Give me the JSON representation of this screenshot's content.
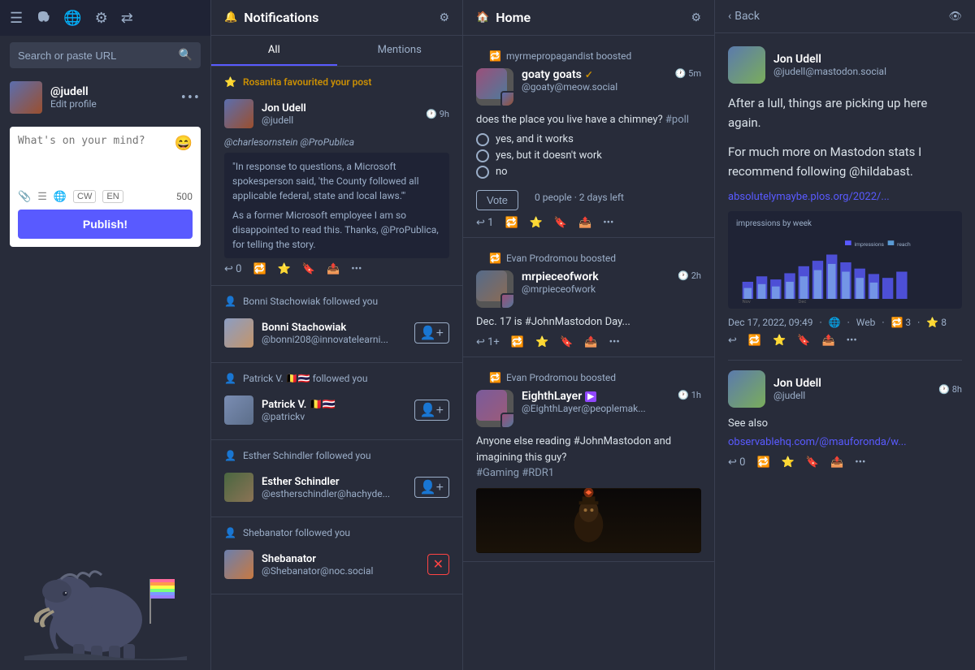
{
  "sidebar": {
    "nav": {
      "menu_icon": "≡",
      "ghost_icon": "👻",
      "globe_icon": "🌐",
      "gear_icon": "⚙",
      "arrows_icon": "⇄"
    },
    "search": {
      "placeholder": "Search or paste URL",
      "icon": "🔍"
    },
    "profile": {
      "handle": "@judell",
      "action": "Edit profile",
      "dots": "•••"
    },
    "compose": {
      "placeholder": "What's on your mind?",
      "emoji": "😄",
      "char_count": "500",
      "cw_label": "CW",
      "en_label": "EN",
      "publish_label": "Publish!"
    }
  },
  "notifications": {
    "header": {
      "icon": "🔔",
      "title": "Notifications",
      "filter_icon": "⚙"
    },
    "tabs": [
      {
        "label": "All",
        "active": true
      },
      {
        "label": "Mentions",
        "active": false
      }
    ],
    "groups": [
      {
        "type": "favourite",
        "icon": "⭐",
        "label_html": "Rosanita favourited your post",
        "user": {
          "name": "Jon Udell",
          "handle": "@judell",
          "time": "9h",
          "avatar_class": "av-jon"
        },
        "mention": "@charlesornstein @ProPublica",
        "text_block": "\"In response to questions, a Microsoft spokesperson said, 'the County followed all applicable federal, state and local laws.'\"",
        "text_block2": "As a former Microsoft employee I am so disappointed to read this. Thanks, @ProPublica, for telling the story.",
        "actions": [
          "↩ 0",
          "🔁",
          "⭐",
          "🔖",
          "📤",
          "•••"
        ]
      },
      {
        "type": "follow",
        "icon": "👤+",
        "label": "Bonni Stachowiak followed you",
        "user": {
          "name": "Bonni Stachowiak",
          "handle": "@bonni208@innovatelearni...",
          "avatar_class": "av-bonni"
        }
      },
      {
        "type": "follow",
        "icon": "👤+",
        "label": "Patrick V.",
        "label2": "🇧🇪🇹🇭 followed you",
        "user": {
          "name": "Patrick V.",
          "flags": "🇧🇪🇹🇭",
          "handle": "@patrickv",
          "avatar_class": "av-patrick"
        }
      },
      {
        "type": "follow",
        "icon": "👤+",
        "label": "Esther Schindler followed you",
        "user": {
          "name": "Esther Schindler",
          "handle": "@estherschindler@hachyde...",
          "avatar_class": "av-esther"
        }
      },
      {
        "type": "follow",
        "icon": "👤+",
        "label": "Shebanator followed you",
        "user": {
          "name": "Shebanator",
          "handle": "@Shebanator@noc.social",
          "avatar_class": "av-sheba"
        }
      }
    ]
  },
  "home": {
    "header": {
      "icon": "🏠",
      "title": "Home",
      "filter_icon": "⚙"
    },
    "posts": [
      {
        "boost_by": "myrmepropagandist boosted",
        "user": {
          "name": "goaty goats",
          "verified": true,
          "handle": "@goaty@meow.social",
          "time": "5m",
          "avatar_class": "av-goaty"
        },
        "content": "does the place you live have a chimney?",
        "hashtag": "#poll",
        "poll": [
          "yes, and it works",
          "yes, but it doesn't work",
          "no"
        ],
        "vote_label": "Vote",
        "poll_meta": "0 people · 2 days left",
        "actions": [
          "↩ 1",
          "🔁",
          "⭐",
          "🔖",
          "📤",
          "•••"
        ]
      },
      {
        "boost_by": "Evan Prodromou boosted",
        "user": {
          "name": "mrpieceofwork",
          "handle": "@mrpieceofwork",
          "time": "2h",
          "avatar_class": "av-mrpiece"
        },
        "content": "Dec. 17 is #JohnMastodon Day...",
        "actions": [
          "↩ 1+",
          "🔁",
          "⭐",
          "🔖",
          "📤",
          "•••"
        ]
      },
      {
        "boost_by": "Evan Prodromou boosted",
        "user": {
          "name": "EighthLayer",
          "twitch": true,
          "handle": "@EighthLayer@peoplemak...",
          "time": "1h",
          "avatar_class": "av-eighth"
        },
        "content": "Anyone else reading #JohnMastodon and imagining this guy?",
        "tags": "#Gaming #RDR1"
      }
    ]
  },
  "detail": {
    "header": {
      "back_label": "Back",
      "eye_icon": "👁"
    },
    "post": {
      "user": {
        "name": "Jon Udell",
        "handle": "@judell@mastodon.social",
        "avatar_class": "av-detail"
      },
      "text1": "After a lull, things are picking up here again.",
      "text2": "For much more on Mastodon stats I recommend following @hildabast.",
      "link": "absolutelymaybe.plos.org/2022/...",
      "chart_label": "impressions by week",
      "meta": {
        "date": "Dec 17, 2022, 09:49",
        "globe": "🌐",
        "app": "Web",
        "boosts": "🔁 3",
        "favs": "⭐ 8"
      },
      "actions": [
        "↩",
        "🔁",
        "⭐",
        "🔖",
        "📤",
        "•••"
      ]
    },
    "post2": {
      "user": {
        "name": "Jon Udell",
        "handle": "@judell",
        "time": "8h",
        "avatar_class": "av-detail"
      },
      "text": "See also",
      "link": "observablehq.com/@mauforonda/w...",
      "actions": [
        "↩ 0",
        "🔁",
        "⭐",
        "🔖",
        "📤",
        "•••"
      ]
    }
  }
}
